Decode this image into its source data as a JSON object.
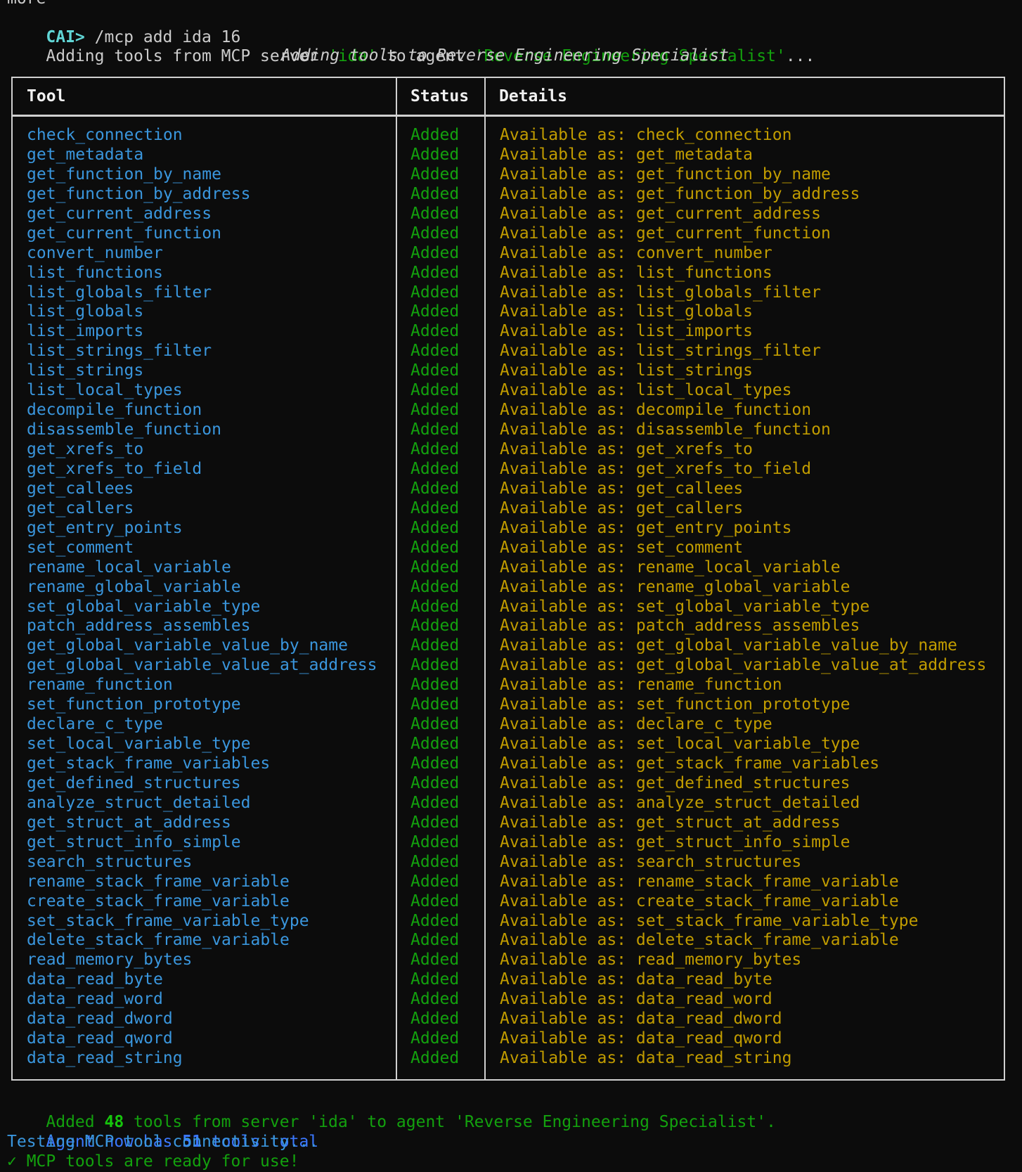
{
  "terminal": {
    "prev_line": "more",
    "prompt": "CAI>",
    "command": " /mcp add ida 16",
    "adding_line": {
      "prefix": "Adding tools from MCP server ",
      "server": "'ida'",
      "middle": " to agent ",
      "agent": "'Reverse Engineering Specialist'",
      "suffix": "..."
    },
    "table_caption": "Adding tools to Reverse Engineering Specialist"
  },
  "table": {
    "headers": {
      "tool": "Tool",
      "status": "Status",
      "details": "Details"
    },
    "details_prefix": "Available as: ",
    "rows": [
      {
        "tool": "check_connection",
        "status": "Added",
        "details": "Available as: check_connection"
      },
      {
        "tool": "get_metadata",
        "status": "Added",
        "details": "Available as: get_metadata"
      },
      {
        "tool": "get_function_by_name",
        "status": "Added",
        "details": "Available as: get_function_by_name"
      },
      {
        "tool": "get_function_by_address",
        "status": "Added",
        "details": "Available as: get_function_by_address"
      },
      {
        "tool": "get_current_address",
        "status": "Added",
        "details": "Available as: get_current_address"
      },
      {
        "tool": "get_current_function",
        "status": "Added",
        "details": "Available as: get_current_function"
      },
      {
        "tool": "convert_number",
        "status": "Added",
        "details": "Available as: convert_number"
      },
      {
        "tool": "list_functions",
        "status": "Added",
        "details": "Available as: list_functions"
      },
      {
        "tool": "list_globals_filter",
        "status": "Added",
        "details": "Available as: list_globals_filter"
      },
      {
        "tool": "list_globals",
        "status": "Added",
        "details": "Available as: list_globals"
      },
      {
        "tool": "list_imports",
        "status": "Added",
        "details": "Available as: list_imports"
      },
      {
        "tool": "list_strings_filter",
        "status": "Added",
        "details": "Available as: list_strings_filter"
      },
      {
        "tool": "list_strings",
        "status": "Added",
        "details": "Available as: list_strings"
      },
      {
        "tool": "list_local_types",
        "status": "Added",
        "details": "Available as: list_local_types"
      },
      {
        "tool": "decompile_function",
        "status": "Added",
        "details": "Available as: decompile_function"
      },
      {
        "tool": "disassemble_function",
        "status": "Added",
        "details": "Available as: disassemble_function"
      },
      {
        "tool": "get_xrefs_to",
        "status": "Added",
        "details": "Available as: get_xrefs_to"
      },
      {
        "tool": "get_xrefs_to_field",
        "status": "Added",
        "details": "Available as: get_xrefs_to_field"
      },
      {
        "tool": "get_callees",
        "status": "Added",
        "details": "Available as: get_callees"
      },
      {
        "tool": "get_callers",
        "status": "Added",
        "details": "Available as: get_callers"
      },
      {
        "tool": "get_entry_points",
        "status": "Added",
        "details": "Available as: get_entry_points"
      },
      {
        "tool": "set_comment",
        "status": "Added",
        "details": "Available as: set_comment"
      },
      {
        "tool": "rename_local_variable",
        "status": "Added",
        "details": "Available as: rename_local_variable"
      },
      {
        "tool": "rename_global_variable",
        "status": "Added",
        "details": "Available as: rename_global_variable"
      },
      {
        "tool": "set_global_variable_type",
        "status": "Added",
        "details": "Available as: set_global_variable_type"
      },
      {
        "tool": "patch_address_assembles",
        "status": "Added",
        "details": "Available as: patch_address_assembles"
      },
      {
        "tool": "get_global_variable_value_by_name",
        "status": "Added",
        "details": "Available as: get_global_variable_value_by_name"
      },
      {
        "tool": "get_global_variable_value_at_address",
        "status": "Added",
        "details": "Available as: get_global_variable_value_at_address"
      },
      {
        "tool": "rename_function",
        "status": "Added",
        "details": "Available as: rename_function"
      },
      {
        "tool": "set_function_prototype",
        "status": "Added",
        "details": "Available as: set_function_prototype"
      },
      {
        "tool": "declare_c_type",
        "status": "Added",
        "details": "Available as: declare_c_type"
      },
      {
        "tool": "set_local_variable_type",
        "status": "Added",
        "details": "Available as: set_local_variable_type"
      },
      {
        "tool": "get_stack_frame_variables",
        "status": "Added",
        "details": "Available as: get_stack_frame_variables"
      },
      {
        "tool": "get_defined_structures",
        "status": "Added",
        "details": "Available as: get_defined_structures"
      },
      {
        "tool": "analyze_struct_detailed",
        "status": "Added",
        "details": "Available as: analyze_struct_detailed"
      },
      {
        "tool": "get_struct_at_address",
        "status": "Added",
        "details": "Available as: get_struct_at_address"
      },
      {
        "tool": "get_struct_info_simple",
        "status": "Added",
        "details": "Available as: get_struct_info_simple"
      },
      {
        "tool": "search_structures",
        "status": "Added",
        "details": "Available as: search_structures"
      },
      {
        "tool": "rename_stack_frame_variable",
        "status": "Added",
        "details": "Available as: rename_stack_frame_variable"
      },
      {
        "tool": "create_stack_frame_variable",
        "status": "Added",
        "details": "Available as: create_stack_frame_variable"
      },
      {
        "tool": "set_stack_frame_variable_type",
        "status": "Added",
        "details": "Available as: set_stack_frame_variable_type"
      },
      {
        "tool": "delete_stack_frame_variable",
        "status": "Added",
        "details": "Available as: delete_stack_frame_variable"
      },
      {
        "tool": "read_memory_bytes",
        "status": "Added",
        "details": "Available as: read_memory_bytes"
      },
      {
        "tool": "data_read_byte",
        "status": "Added",
        "details": "Available as: data_read_byte"
      },
      {
        "tool": "data_read_word",
        "status": "Added",
        "details": "Available as: data_read_word"
      },
      {
        "tool": "data_read_dword",
        "status": "Added",
        "details": "Available as: data_read_dword"
      },
      {
        "tool": "data_read_qword",
        "status": "Added",
        "details": "Available as: data_read_qword"
      },
      {
        "tool": "data_read_string",
        "status": "Added",
        "details": "Available as: data_read_string"
      }
    ]
  },
  "summary": {
    "added_prefix": "Added ",
    "added_count": "48",
    "added_suffix": " tools from server 'ida' to agent 'Reverse Engineering Specialist'.",
    "total_prefix": "Agent now has ",
    "total_count": "51",
    "total_suffix": " tools total",
    "testing": "Testing MCP tool connectivity...",
    "ready": "✓ MCP tools are ready for use!"
  },
  "colors": {
    "background": "#0c0c0c",
    "tool_name": "#3a96dd",
    "status_added": "#13a10e",
    "details": "#c19c00",
    "prompt": "#61d6d6"
  }
}
